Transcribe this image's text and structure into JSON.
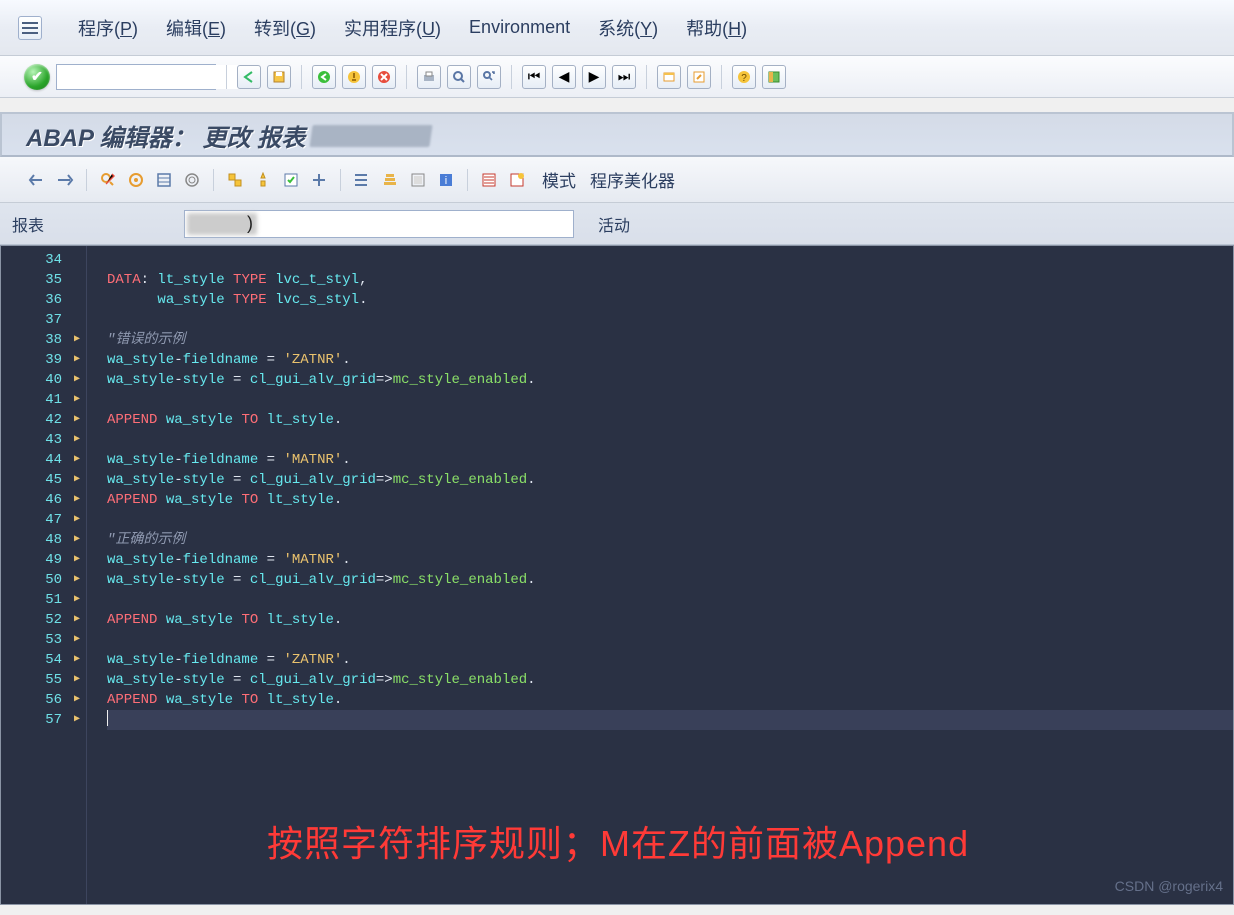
{
  "menu": {
    "items": [
      {
        "pre": "程序(",
        "u": "P",
        "post": ")"
      },
      {
        "pre": "编辑(",
        "u": "E",
        "post": ")"
      },
      {
        "pre": "转到(",
        "u": "G",
        "post": ")"
      },
      {
        "pre": "实用程序(",
        "u": "U",
        "post": ")"
      },
      {
        "pre": "Environment",
        "u": "",
        "post": ""
      },
      {
        "pre": "系统(",
        "u": "Y",
        "post": ")"
      },
      {
        "pre": "帮助(",
        "u": "H",
        "post": ")"
      }
    ]
  },
  "title": {
    "text": "ABAP 编辑器： 更改 报表 "
  },
  "app_toolbar": {
    "mode_label": "模式",
    "beautifier_label": "程序美化器"
  },
  "field_row": {
    "label": "报表",
    "status": "活动"
  },
  "editor_lines": [
    34,
    35,
    36,
    37,
    38,
    39,
    40,
    41,
    42,
    43,
    44,
    45,
    46,
    47,
    48,
    49,
    50,
    51,
    52,
    53,
    54,
    55,
    56,
    57
  ],
  "editor_arrows_from": 38,
  "cursor_at": 57,
  "comments": {
    "wrong": "\"错误的示例",
    "correct": "\"正确的示例"
  },
  "annotation": "按照字符排序规则；M在Z的前面被Append",
  "watermark": "CSDN @rogerix4"
}
